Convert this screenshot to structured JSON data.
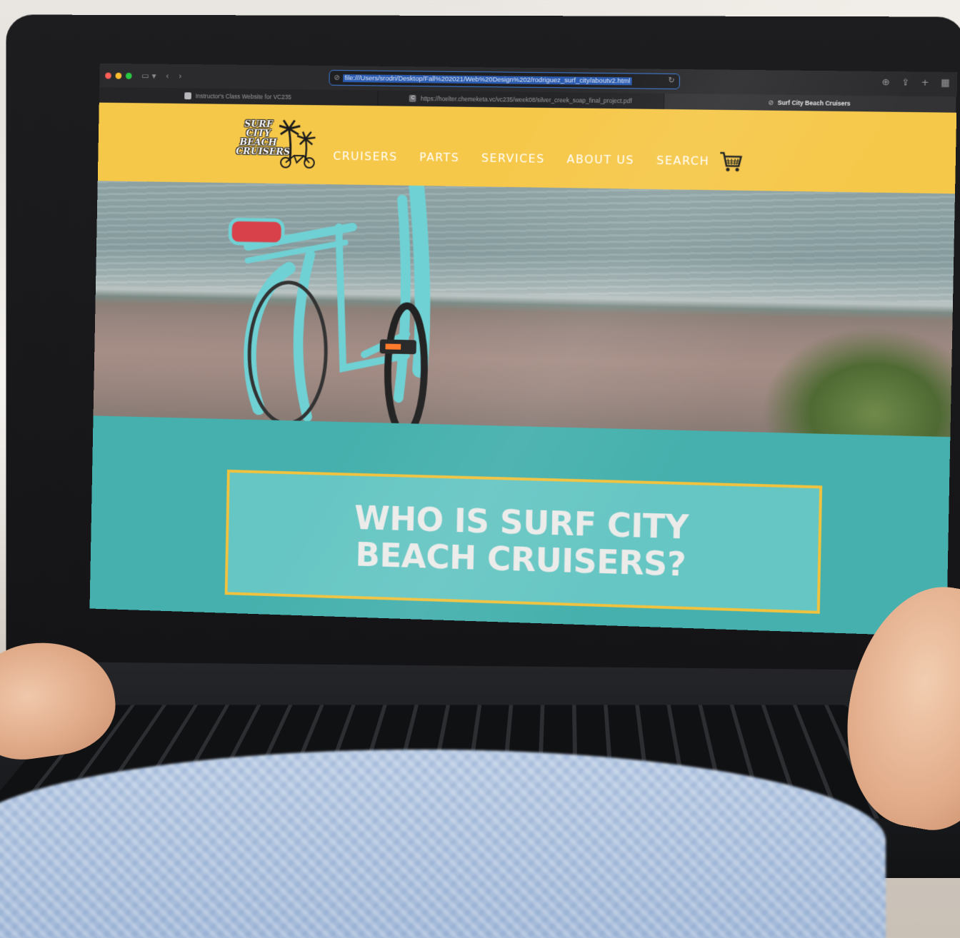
{
  "browser": {
    "address_url": "file:///Users/srodri/Desktop/Fall%202021/Web%20Design%202/rodriguez_surf_city/aboutv2.html",
    "tabs": [
      {
        "label": "Instructor's Class Website for VC235",
        "active": false
      },
      {
        "label": "https://hoelter.chemeketa.vc/vc235/week08/silver_creek_soap_final_project.pdf",
        "active": false
      },
      {
        "label": "Surf City Beach Cruisers",
        "active": true
      }
    ],
    "favicon_letter": "C"
  },
  "site": {
    "logo": [
      "SURF",
      "CITY",
      "BEACH",
      "CRUISERS"
    ],
    "nav": [
      "CRUISERS",
      "PARTS",
      "SERVICES",
      "ABOUT US",
      "SEARCH"
    ],
    "hero_title": "WHO IS SURF CITY BEACH CRUISERS?"
  },
  "colors": {
    "header_bg": "#f6c84a",
    "section_bg": "#45b0ad",
    "title_box_bg": "#66c6c3",
    "title_box_border": "#f0c23e",
    "bike": "#6fd1d4"
  },
  "icons": {
    "cart": "shopping-cart-icon",
    "logo_art": "palm-trees-bicycle-icon"
  }
}
